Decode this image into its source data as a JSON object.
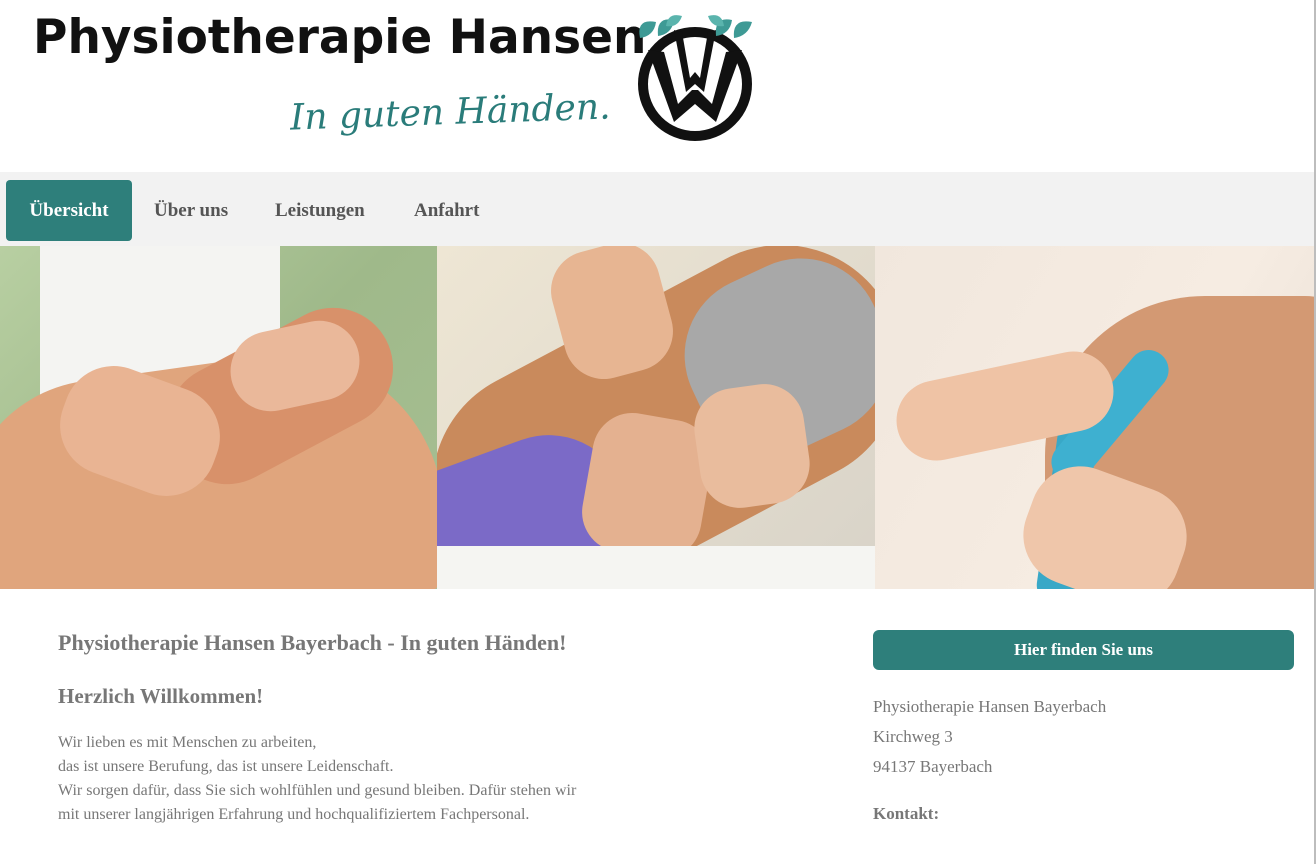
{
  "header": {
    "title": "Physiotherapie Hansen",
    "tagline": "In guten Händen.",
    "logo_icon": "hands-lotus-logo",
    "accent_color": "#2e7f7b"
  },
  "nav": {
    "items": [
      {
        "label": "Übersicht",
        "active": true
      },
      {
        "label": "Über uns",
        "active": false
      },
      {
        "label": "Leistungen",
        "active": false
      },
      {
        "label": "Anfahrt",
        "active": false
      }
    ]
  },
  "hero": {
    "images": [
      "knee-massage-photo",
      "back-massage-photo",
      "shoulder-kinesio-tape-photo"
    ]
  },
  "main": {
    "heading": "Physiotherapie Hansen Bayerbach - In guten Händen!",
    "subheading": "Herzlich Willkommen!",
    "lines": [
      "Wir lieben es mit Menschen zu arbeiten,",
      "das ist unsere Berufung, das ist unsere Leidenschaft.",
      "Wir sorgen dafür, dass Sie sich wohlfühlen und gesund bleiben. Dafür stehen wir",
      "mit unserer langjährigen Erfahrung und hochqualifiziertem Fachpersonal."
    ]
  },
  "sidebar": {
    "button_label": "Hier finden Sie uns",
    "address_lines": [
      "Physiotherapie Hansen Bayerbach",
      "Kirchweg 3",
      "94137 Bayerbach"
    ],
    "contact_heading": "Kontakt:"
  }
}
